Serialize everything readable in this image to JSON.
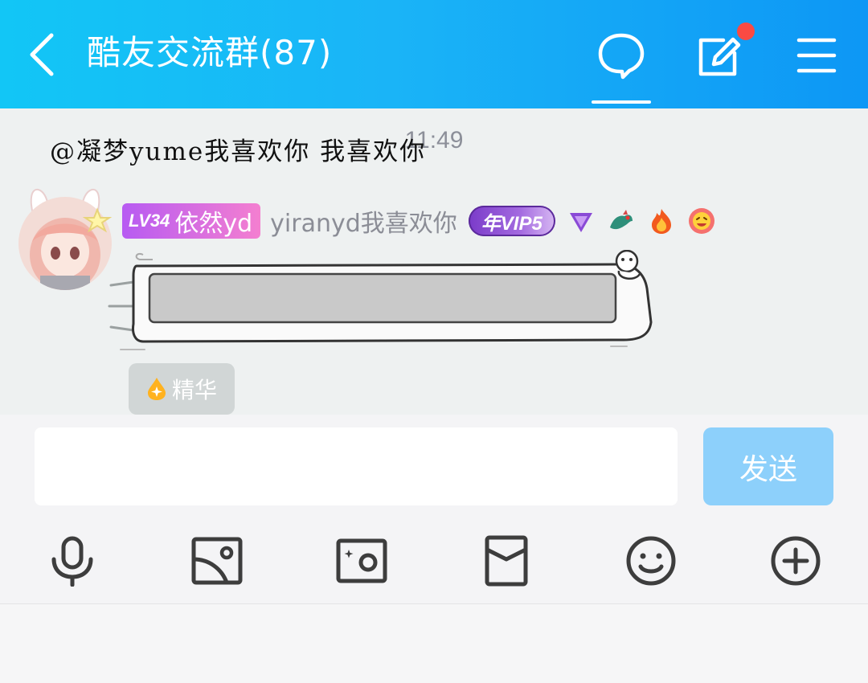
{
  "header": {
    "title": "酷友交流群(87)",
    "background": "#12c6f6"
  },
  "chat": {
    "timestamp": "11:49",
    "message": {
      "level": "LV34",
      "level_name": "依然yd",
      "nickname": "yiranyd我喜欢你",
      "vip_label": "年VIP5",
      "text": "@凝梦yume我喜欢你 我喜欢你",
      "medals": [
        "triangle-medal",
        "dragon-medal",
        "fire-medal",
        "sticker-medal"
      ]
    },
    "essence_label": "精华"
  },
  "composer": {
    "placeholder": "",
    "send_label": "发送",
    "send_color": "#8dd0fb"
  },
  "toolbar": {
    "icons": [
      "microphone-icon",
      "image-icon",
      "camera-icon",
      "red-packet-icon",
      "emoji-icon",
      "plus-circle-icon"
    ]
  }
}
